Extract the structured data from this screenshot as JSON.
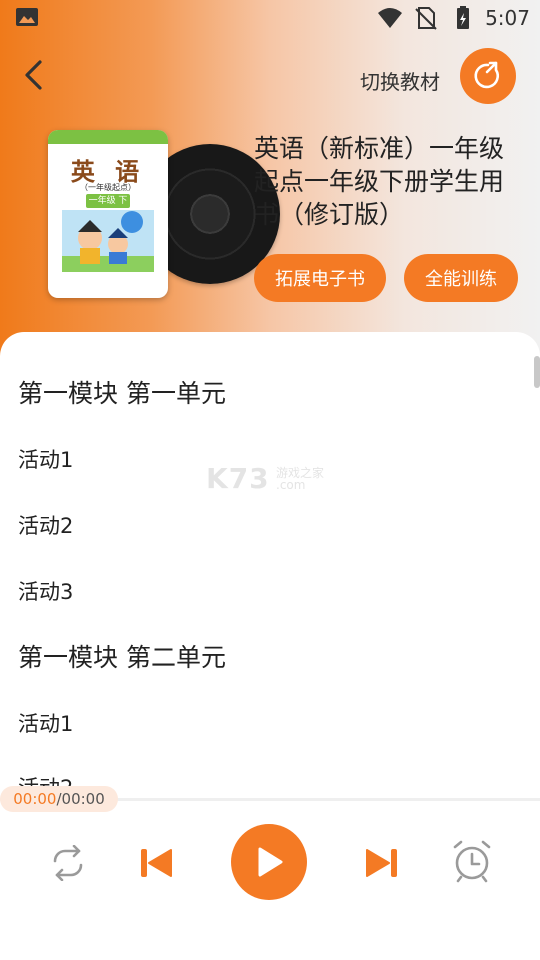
{
  "status_bar": {
    "time": "5:07",
    "icons": [
      "image-icon",
      "wifi-icon",
      "no-sim-icon",
      "battery-icon"
    ]
  },
  "header": {
    "back_icon": "back-arrow-icon",
    "switch_label": "切换教材",
    "switch_icon": "switch-arrow-icon",
    "book": {
      "cover_title": "英 语",
      "cover_subtitle": "（一年级起点）",
      "cover_grade": "一年级 下册",
      "name": "英语（新标准）一年级起点一年级下册学生用书（修订版）"
    },
    "buttons": {
      "ebook": "拓展电子书",
      "training": "全能训练"
    }
  },
  "list": [
    {
      "type": "unit",
      "label": "第一模块 第一单元"
    },
    {
      "type": "activity",
      "label": "活动1"
    },
    {
      "type": "activity",
      "label": "活动2"
    },
    {
      "type": "activity",
      "label": "活动3"
    },
    {
      "type": "unit",
      "label": "第一模块 第二单元"
    },
    {
      "type": "activity",
      "label": "活动1"
    },
    {
      "type": "activity",
      "label": "活动2"
    }
  ],
  "watermark": {
    "brand": "K73",
    "cn": "游戏之家",
    "com": ".com"
  },
  "player": {
    "current_time": "00:00",
    "total_time": "00:00",
    "progress": 0,
    "controls": [
      "loop-icon",
      "previous-icon",
      "play-icon",
      "next-icon",
      "alarm-clock-icon"
    ]
  },
  "colors": {
    "accent": "#f47a24",
    "accent_light": "#fde9dd",
    "text": "#222222"
  }
}
